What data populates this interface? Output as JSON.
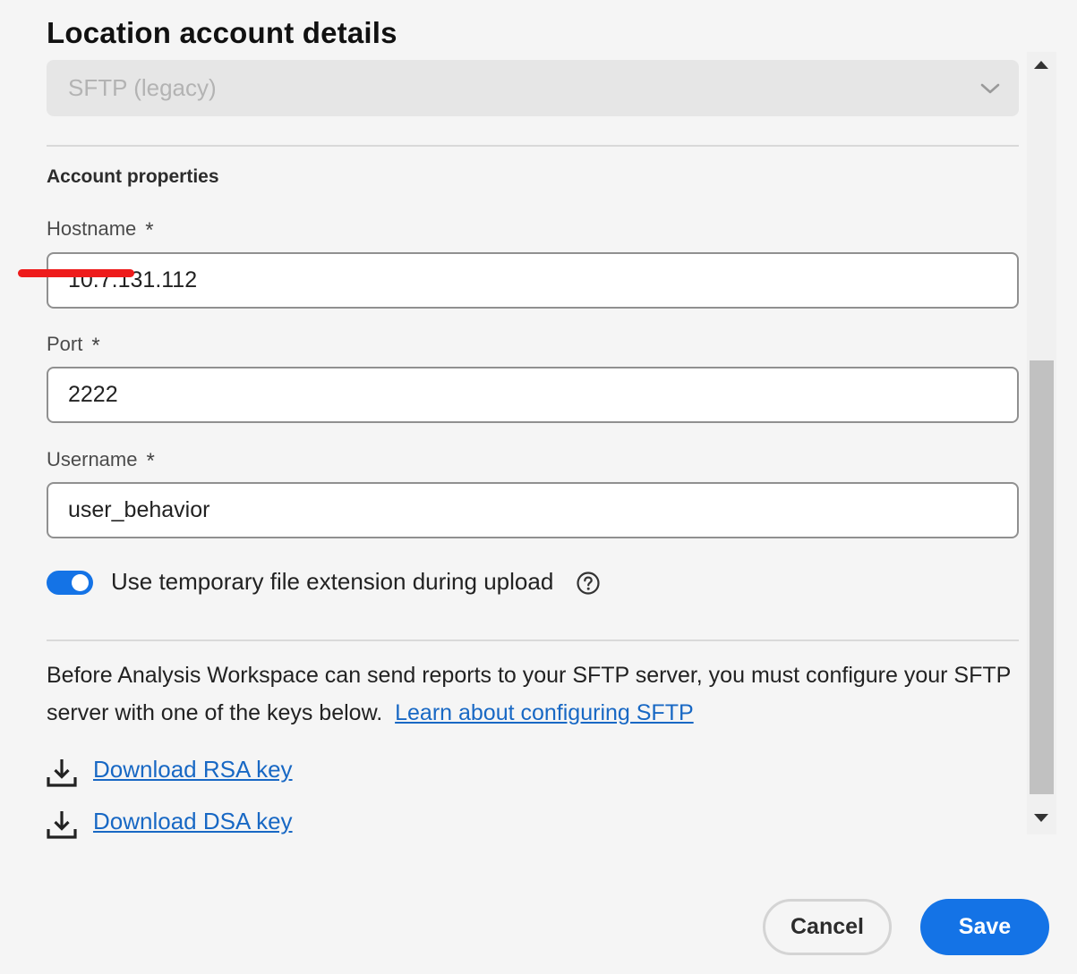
{
  "section": {
    "title": "Location account details"
  },
  "account_type": {
    "selected": "SFTP (legacy)"
  },
  "account_properties": {
    "heading": "Account properties",
    "required_marker": "*",
    "hostname": {
      "label": "Hostname",
      "value": "10.7.131.112"
    },
    "port": {
      "label": "Port",
      "value": "2222"
    },
    "username": {
      "label": "Username",
      "value": "user_behavior"
    }
  },
  "temp_extension": {
    "label": "Use temporary file extension during upload",
    "enabled": true
  },
  "info": {
    "text": "Before Analysis Workspace can send reports to your SFTP server, you must configure your SFTP server with one of the keys below.",
    "link_text": "Learn about configuring SFTP"
  },
  "downloads": {
    "rsa_label": "Download RSA key",
    "dsa_label": "Download DSA key"
  },
  "footer": {
    "cancel_label": "Cancel",
    "save_label": "Save"
  },
  "colors": {
    "accent": "#1473e6",
    "link": "#1868c4",
    "redaction": "#ee1b1b"
  },
  "icons": {
    "dropdown": "chevron-down-icon",
    "help": "help-icon",
    "download": "download-icon"
  }
}
